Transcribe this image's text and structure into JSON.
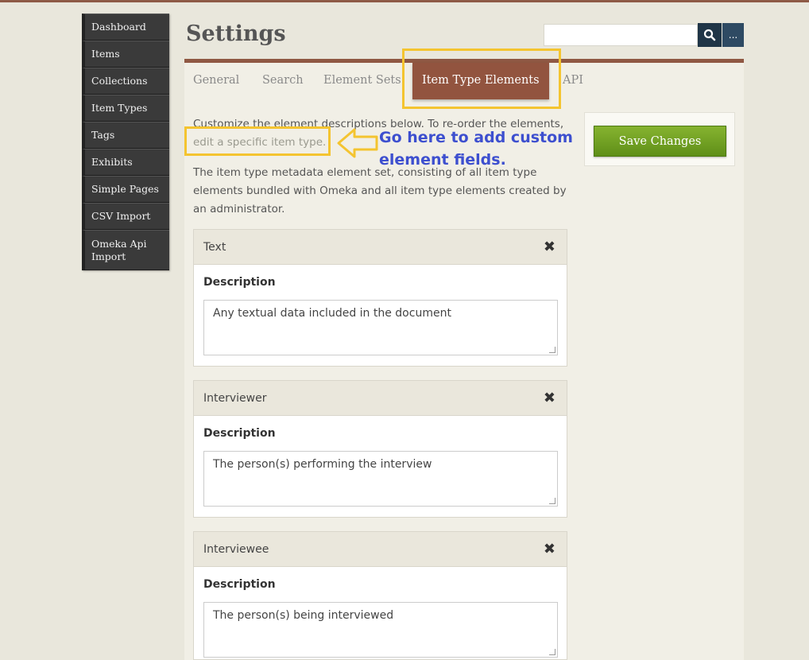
{
  "sidebar": {
    "items": [
      {
        "label": "Dashboard"
      },
      {
        "label": "Items"
      },
      {
        "label": "Collections"
      },
      {
        "label": "Item Types"
      },
      {
        "label": "Tags"
      },
      {
        "label": "Exhibits"
      },
      {
        "label": "Simple Pages"
      },
      {
        "label": "CSV Import"
      },
      {
        "label": "Omeka Api Import"
      }
    ]
  },
  "header": {
    "title": "Settings",
    "search_value": "",
    "more_label": "..."
  },
  "tabs": [
    {
      "label": "General"
    },
    {
      "label": "Search"
    },
    {
      "label": "Element Sets"
    },
    {
      "label": "Item Type Elements",
      "active": true
    },
    {
      "label": "API"
    }
  ],
  "intro": {
    "text": "Customize the element descriptions below. To re-order the elements,",
    "link": "edit a specific item type."
  },
  "set_description": "The item type metadata element set, consisting of all item type elements bundled with Omeka and all item type elements created by an administrator.",
  "annotation": "Go here to add custom element fields.",
  "save_button": "Save Changes",
  "elements": [
    {
      "name": "Text",
      "label": "Description",
      "value": "Any textual data included in the document"
    },
    {
      "name": "Interviewer",
      "label": "Description",
      "value": "The person(s) performing the interview"
    },
    {
      "name": "Interviewee",
      "label": "Description",
      "value": "The person(s) being interviewed"
    }
  ],
  "colors": {
    "accent": "#92543f",
    "highlight": "#f4c430",
    "annotation": "#3d4fcf",
    "save": "#6fa122"
  }
}
